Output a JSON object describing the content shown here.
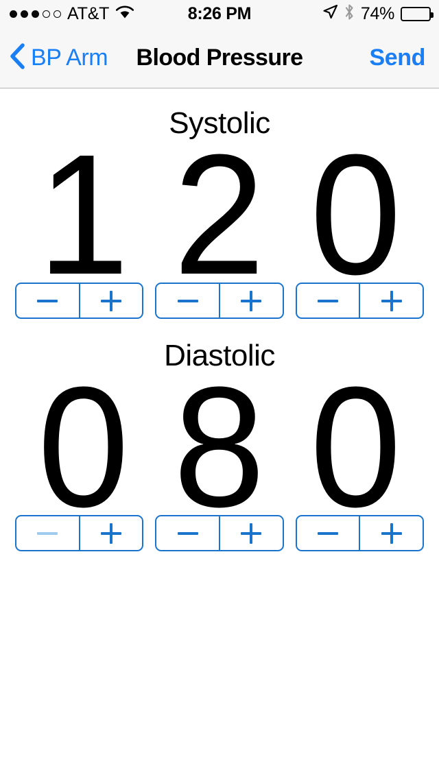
{
  "status_bar": {
    "signal_dots_total": 5,
    "signal_dots_filled": 3,
    "carrier": "AT&T",
    "wifi_icon": "wifi-icon",
    "time": "8:26 PM",
    "location_icon": "location-arrow-icon",
    "bluetooth_icon": "bluetooth-icon",
    "battery_percent_label": "74%",
    "battery_level": 74
  },
  "nav_bar": {
    "back_icon": "chevron-left-icon",
    "back_label": "BP Arm",
    "title": "Blood Pressure",
    "send_label": "Send",
    "tint_color": "#1a7ef5",
    "background_color": "#f7f7f7"
  },
  "measurement": {
    "stepper_tint": "#1b74cc",
    "stepper_disabled_tint": "#9ecbee",
    "systolic": {
      "label": "Systolic",
      "value": "120",
      "digits": [
        {
          "value": "1",
          "minus_label": "−",
          "plus_label": "+",
          "minus_disabled": false,
          "plus_disabled": false
        },
        {
          "value": "2",
          "minus_label": "−",
          "plus_label": "+",
          "minus_disabled": false,
          "plus_disabled": false
        },
        {
          "value": "0",
          "minus_label": "−",
          "plus_label": "+",
          "minus_disabled": false,
          "plus_disabled": false
        }
      ]
    },
    "diastolic": {
      "label": "Diastolic",
      "value": "080",
      "digits": [
        {
          "value": "0",
          "minus_label": "−",
          "plus_label": "+",
          "minus_disabled": true,
          "plus_disabled": false
        },
        {
          "value": "8",
          "minus_label": "−",
          "plus_label": "+",
          "minus_disabled": false,
          "plus_disabled": false
        },
        {
          "value": "0",
          "minus_label": "−",
          "plus_label": "+",
          "minus_disabled": false,
          "plus_disabled": false
        }
      ]
    }
  }
}
